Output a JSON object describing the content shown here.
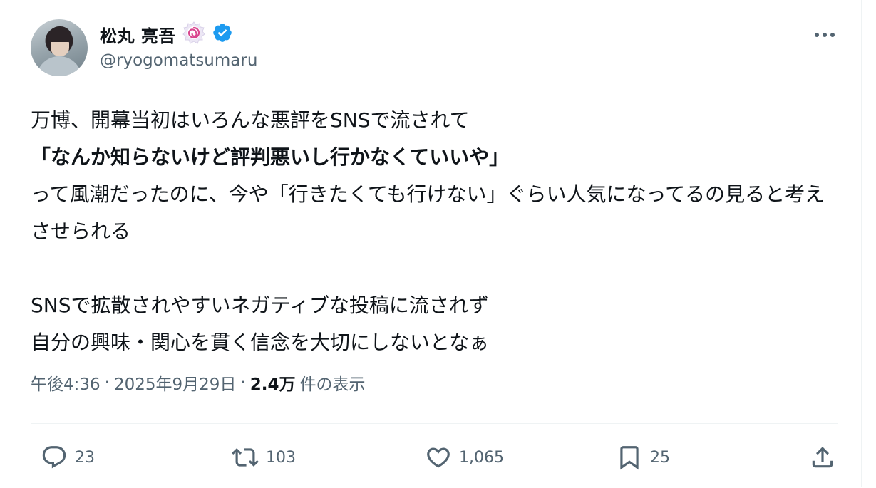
{
  "author": {
    "display_name": "松丸 亮吾",
    "handle": "@ryogomatsumaru"
  },
  "tweet": {
    "line1": "万博、開幕当初はいろんな悪評をSNSで流されて",
    "line2": "「なんか知らないけど評判悪いし行かなくていいや」",
    "line3": "って風潮だったのに、今や「行きたくても行けない」ぐらい人気になってるの見ると考えさせられる",
    "line4": "SNSで拡散されやすいネガティブな投稿に流されず",
    "line5": "自分の興味・関心を貫く信念を大切にしないとなぁ"
  },
  "meta": {
    "time": "午後4:36",
    "date": "2025年9月29日",
    "views_count": "2.4万",
    "views_label": "件の表示",
    "sep": "·"
  },
  "actions": {
    "replies": "23",
    "retweets": "103",
    "likes": "1,065",
    "bookmarks": "25"
  },
  "colors": {
    "verified": "#1d9bf0",
    "secondary_text": "#536471",
    "text": "#0f1419"
  },
  "icons": [
    "more-icon",
    "verified-badge-icon",
    "affiliate-badge-icon",
    "reply-icon",
    "retweet-icon",
    "like-icon",
    "bookmark-icon",
    "share-icon"
  ]
}
